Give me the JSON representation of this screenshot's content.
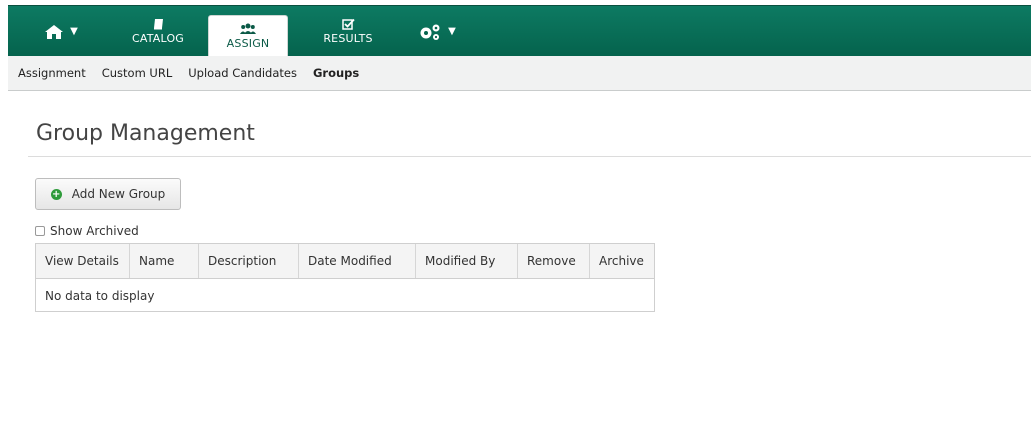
{
  "nav": {
    "catalog_label": "CATALOG",
    "assign_label": "ASSIGN",
    "results_label": "RESULTS"
  },
  "subnav": [
    "Assignment",
    "Custom URL",
    "Upload Candidates",
    "Groups"
  ],
  "page": {
    "title": "Group Management",
    "add_button": "Add New Group",
    "show_archived": "Show Archived"
  },
  "table": {
    "columns": [
      "View Details",
      "Name",
      "Description",
      "Date Modified",
      "Modified By",
      "Remove",
      "Archive"
    ],
    "empty_text": "No data to display"
  },
  "colors": {
    "brand": "#05634d",
    "accent": "#2e9b3a"
  },
  "icons": [
    "home-icon",
    "book-icon",
    "users-icon",
    "checkbox-icon",
    "gears-icon"
  ]
}
